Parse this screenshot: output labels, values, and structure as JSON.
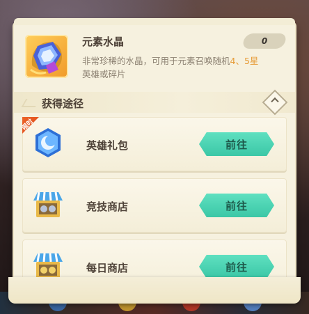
{
  "item": {
    "name": "元素水晶",
    "count": "0",
    "description_part1": "非常珍稀的水晶，可用于元素召唤随机",
    "description_hl1": "4、5星",
    "description_part2": "英雄或碎片"
  },
  "section": {
    "title": "获得途径"
  },
  "sources": [
    {
      "label": "英雄礼包",
      "button": "前往",
      "tag": "限时"
    },
    {
      "label": "竞技商店",
      "button": "前往"
    },
    {
      "label": "每日商店",
      "button": "前往"
    }
  ],
  "colors": {
    "panel_bg": "#f6f1df",
    "button_teal": "#3bc7a6",
    "highlight_orange": "#e69a35",
    "text_dark": "#4e4238"
  },
  "icons": {
    "item": "element-crystal-icon",
    "hero_pack": "blue-gem-icon",
    "arena_shop": "shop-stall-icon",
    "daily_shop": "shop-stall-icon",
    "toggle": "collapse-up-icon"
  }
}
